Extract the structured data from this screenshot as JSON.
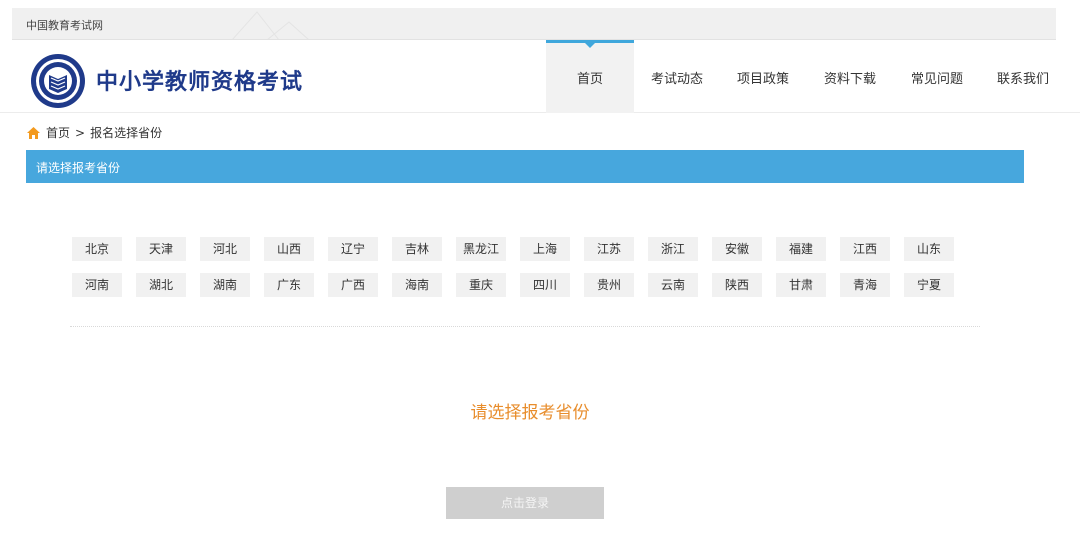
{
  "topbar": {
    "site_name": "中国教育考试网"
  },
  "header": {
    "title": "中小学教师资格考试",
    "logo_icon": "emblem-book-icon"
  },
  "nav": [
    {
      "label": "首页",
      "active": true
    },
    {
      "label": "考试动态"
    },
    {
      "label": "项目政策"
    },
    {
      "label": "资料下载"
    },
    {
      "label": "常见问题"
    },
    {
      "label": "联系我们"
    }
  ],
  "breadcrumb": {
    "home": "首页",
    "separator": ">",
    "current": "报名选择省份",
    "icon": "home-icon"
  },
  "section": {
    "title": "请选择报考省份"
  },
  "provinces": {
    "row1": [
      "北京",
      "天津",
      "河北",
      "山西",
      "辽宁",
      "吉林",
      "黑龙江",
      "上海",
      "江苏",
      "浙江",
      "安徽",
      "福建",
      "江西",
      "山东"
    ],
    "row2": [
      "河南",
      "湖北",
      "湖南",
      "广东",
      "广西",
      "海南",
      "重庆",
      "四川",
      "贵州",
      "云南",
      "陕西",
      "甘肃",
      "青海",
      "宁夏"
    ]
  },
  "prompt": "请选择报考省份",
  "login_button": "点击登录",
  "colors": {
    "accent_blue": "#47a7dd",
    "title_blue": "#1f3a8a",
    "prompt_orange": "#e88d2c",
    "button_disabled": "#cfcfcf"
  }
}
